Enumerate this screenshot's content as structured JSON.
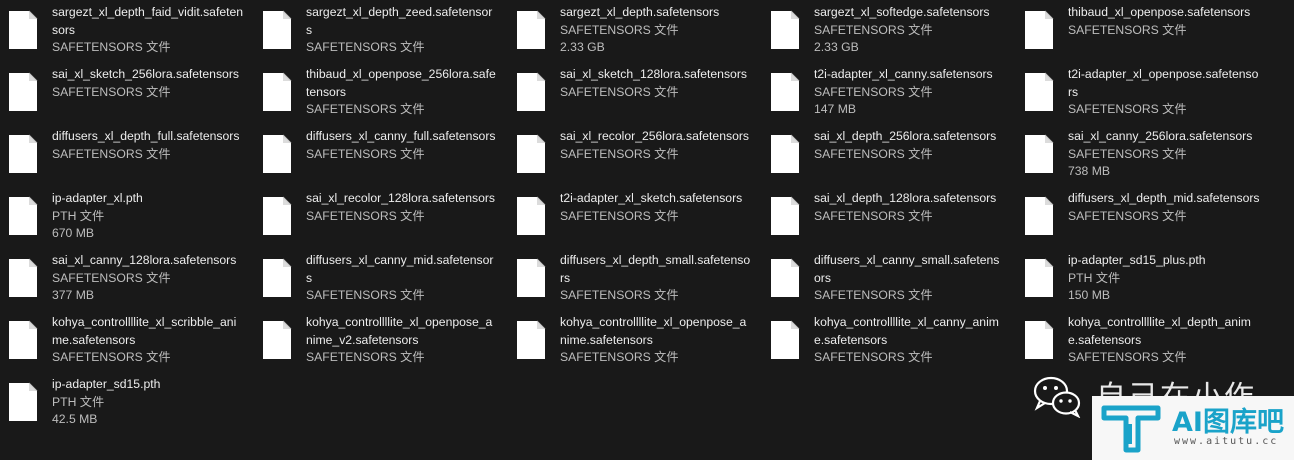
{
  "files": [
    {
      "name": "sargezt_xl_depth_faid_vidit.safetensors",
      "type": "SAFETENSORS 文件",
      "size": ""
    },
    {
      "name": "sargezt_xl_depth_zeed.safetensors",
      "type": "SAFETENSORS 文件",
      "size": ""
    },
    {
      "name": "sargezt_xl_depth.safetensors",
      "type": "SAFETENSORS 文件",
      "size": "2.33 GB"
    },
    {
      "name": "sargezt_xl_softedge.safetensors",
      "type": "SAFETENSORS 文件",
      "size": "2.33 GB"
    },
    {
      "name": "thibaud_xl_openpose.safetensors",
      "type": "SAFETENSORS 文件",
      "size": ""
    },
    {
      "name": "sai_xl_sketch_256lora.safetensors",
      "type": "SAFETENSORS 文件",
      "size": ""
    },
    {
      "name": "thibaud_xl_openpose_256lora.safetensors",
      "type": "SAFETENSORS 文件",
      "size": ""
    },
    {
      "name": "sai_xl_sketch_128lora.safetensors",
      "type": "SAFETENSORS 文件",
      "size": ""
    },
    {
      "name": "t2i-adapter_xl_canny.safetensors",
      "type": "SAFETENSORS 文件",
      "size": "147 MB"
    },
    {
      "name": "t2i-adapter_xl_openpose.safetensors",
      "type": "SAFETENSORS 文件",
      "size": ""
    },
    {
      "name": "diffusers_xl_depth_full.safetensors",
      "type": "SAFETENSORS 文件",
      "size": ""
    },
    {
      "name": "diffusers_xl_canny_full.safetensors",
      "type": "SAFETENSORS 文件",
      "size": ""
    },
    {
      "name": "sai_xl_recolor_256lora.safetensors",
      "type": "SAFETENSORS 文件",
      "size": ""
    },
    {
      "name": "sai_xl_depth_256lora.safetensors",
      "type": "SAFETENSORS 文件",
      "size": ""
    },
    {
      "name": "sai_xl_canny_256lora.safetensors",
      "type": "SAFETENSORS 文件",
      "size": "738 MB"
    },
    {
      "name": "ip-adapter_xl.pth",
      "type": "PTH 文件",
      "size": "670 MB"
    },
    {
      "name": "sai_xl_recolor_128lora.safetensors",
      "type": "SAFETENSORS 文件",
      "size": ""
    },
    {
      "name": "t2i-adapter_xl_sketch.safetensors",
      "type": "SAFETENSORS 文件",
      "size": ""
    },
    {
      "name": "sai_xl_depth_128lora.safetensors",
      "type": "SAFETENSORS 文件",
      "size": ""
    },
    {
      "name": "diffusers_xl_depth_mid.safetensors",
      "type": "SAFETENSORS 文件",
      "size": ""
    },
    {
      "name": "sai_xl_canny_128lora.safetensors",
      "type": "SAFETENSORS 文件",
      "size": "377 MB"
    },
    {
      "name": "diffusers_xl_canny_mid.safetensors",
      "type": "SAFETENSORS 文件",
      "size": ""
    },
    {
      "name": "diffusers_xl_depth_small.safetensors",
      "type": "SAFETENSORS 文件",
      "size": ""
    },
    {
      "name": "diffusers_xl_canny_small.safetensors",
      "type": "SAFETENSORS 文件",
      "size": ""
    },
    {
      "name": "ip-adapter_sd15_plus.pth",
      "type": "PTH 文件",
      "size": "150 MB"
    },
    {
      "name": "kohya_controllllite_xl_scribble_anime.safetensors",
      "type": "SAFETENSORS 文件",
      "size": ""
    },
    {
      "name": "kohya_controllllite_xl_openpose_anime_v2.safetensors",
      "type": "SAFETENSORS 文件",
      "size": ""
    },
    {
      "name": "kohya_controllllite_xl_openpose_anime.safetensors",
      "type": "SAFETENSORS 文件",
      "size": ""
    },
    {
      "name": "kohya_controllllite_xl_canny_anime.safetensors",
      "type": "SAFETENSORS 文件",
      "size": ""
    },
    {
      "name": "kohya_controllllite_xl_depth_anime.safetensors",
      "type": "SAFETENSORS 文件",
      "size": ""
    },
    {
      "name": "ip-adapter_sd15.pth",
      "type": "PTH 文件",
      "size": "42.5 MB"
    }
  ],
  "watermark": {
    "channel_text": "自己在小作",
    "brand": "AI图库吧",
    "url": "www.aitutu.cc"
  },
  "colors": {
    "background": "#191919",
    "text_primary": "#ededed",
    "text_secondary": "#bdbdbd",
    "file_icon": "#ffffff",
    "brand_accent": "#1aa3c9"
  },
  "icons": {
    "file": "blank-document-icon",
    "watermark_social": "wechat-icon",
    "watermark_logo": "aitutu-logo-icon"
  }
}
